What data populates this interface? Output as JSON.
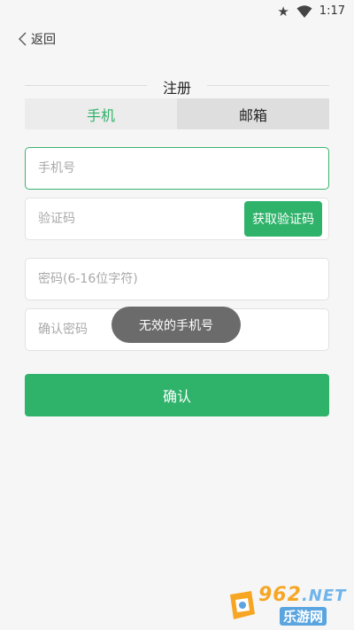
{
  "status_bar": {
    "time": "1:17",
    "icons": [
      "star-icon",
      "wifi-icon"
    ]
  },
  "header": {
    "back_label": "返回"
  },
  "title": "注册",
  "tabs": [
    {
      "label": "手机",
      "selected": true
    },
    {
      "label": "邮箱",
      "selected": false
    }
  ],
  "form": {
    "phone_placeholder": "手机号",
    "code_placeholder": "验证码",
    "get_code_label": "获取验证码",
    "password_placeholder": "密码(6-16位字符)",
    "confirm_password_placeholder": "确认密码",
    "confirm_label": "确认"
  },
  "toast": "无效的手机号",
  "watermark": {
    "main": "962",
    "net": ".NET",
    "sub": "乐游网"
  },
  "colors": {
    "accent": "#2fb26a",
    "background": "#f6f6f6",
    "toast": "#6b6b6b"
  }
}
